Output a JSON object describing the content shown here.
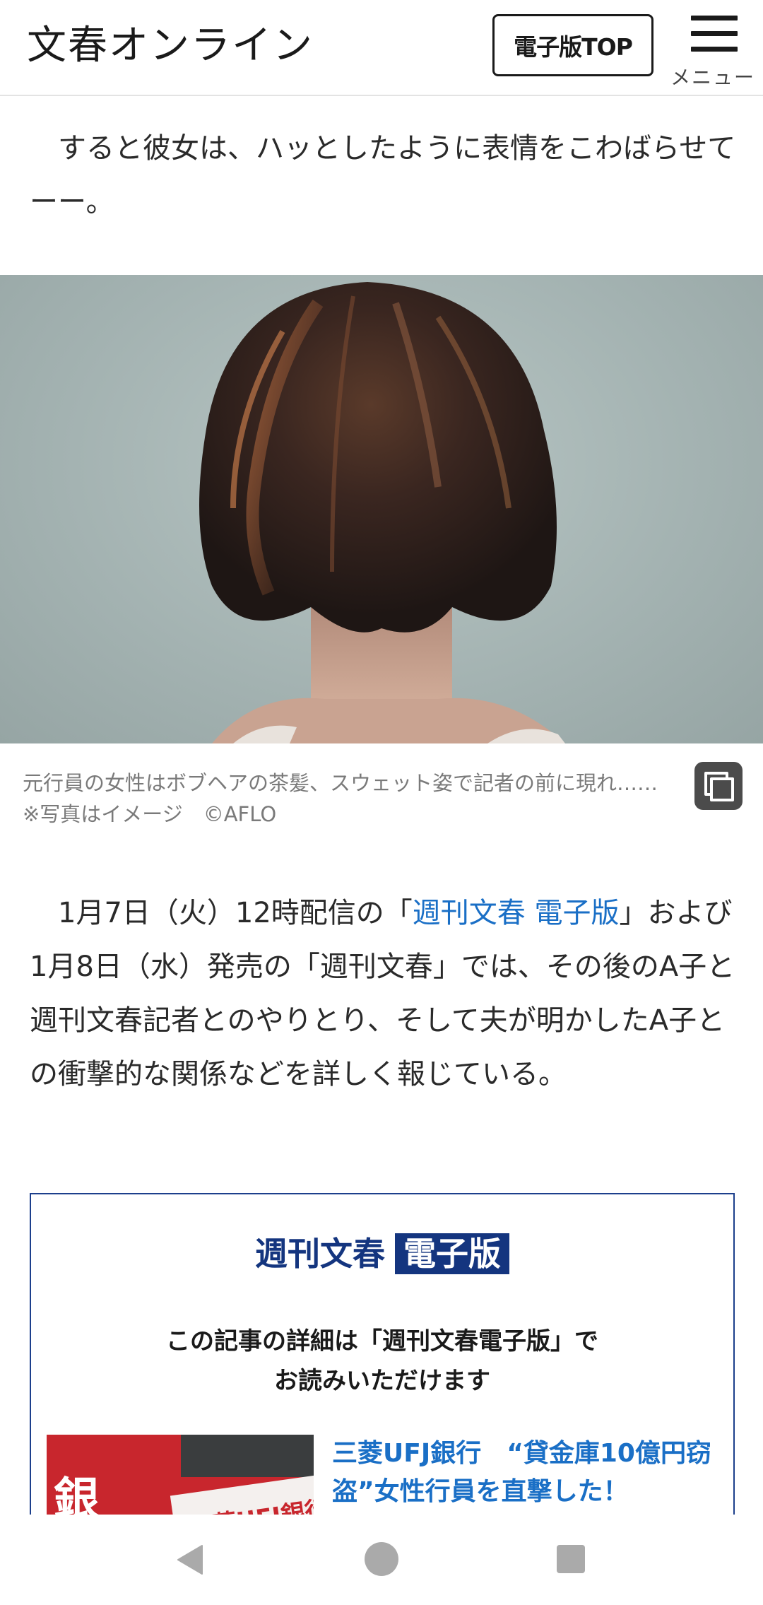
{
  "header": {
    "logo_text": "文春オンライン",
    "top_button_label": "電子版TOP",
    "menu_label": "メニュー"
  },
  "article": {
    "paragraph1": "　すると彼女は、ハッとしたように表情をこわばらせてーー。",
    "image_caption": "元行員の女性はボブヘアの茶髪、スウェット姿で記者の前に現れ……　※写真はイメージ　©AFLO",
    "paragraph2_prefix": "　1月7日（火）12時配信の「",
    "paragraph2_link": "週刊文春 電子版",
    "paragraph2_suffix": "」および1月8日（水）発売の「週刊文春」では、その後のA子と週刊文春記者とのやりとり、そして夫が明かしたA子との衝撃的な関係などを詳しく報じている。"
  },
  "promo": {
    "logo_main": "週刊文春",
    "logo_badge": "電子版",
    "text_line1": "この記事の詳細は「週刊文春電子版」で",
    "text_line2": "お読みいただけます",
    "thumb_text": "銀",
    "thumb_sign": "三菱UFJ銀行",
    "article_title": "三菱UFJ銀行　“貸金庫10億円窃盗”女性行員を直撃した！"
  },
  "colors": {
    "link": "#1a6fc6",
    "promo_border": "#1c3f8c",
    "promo_brand": "#14357f"
  }
}
